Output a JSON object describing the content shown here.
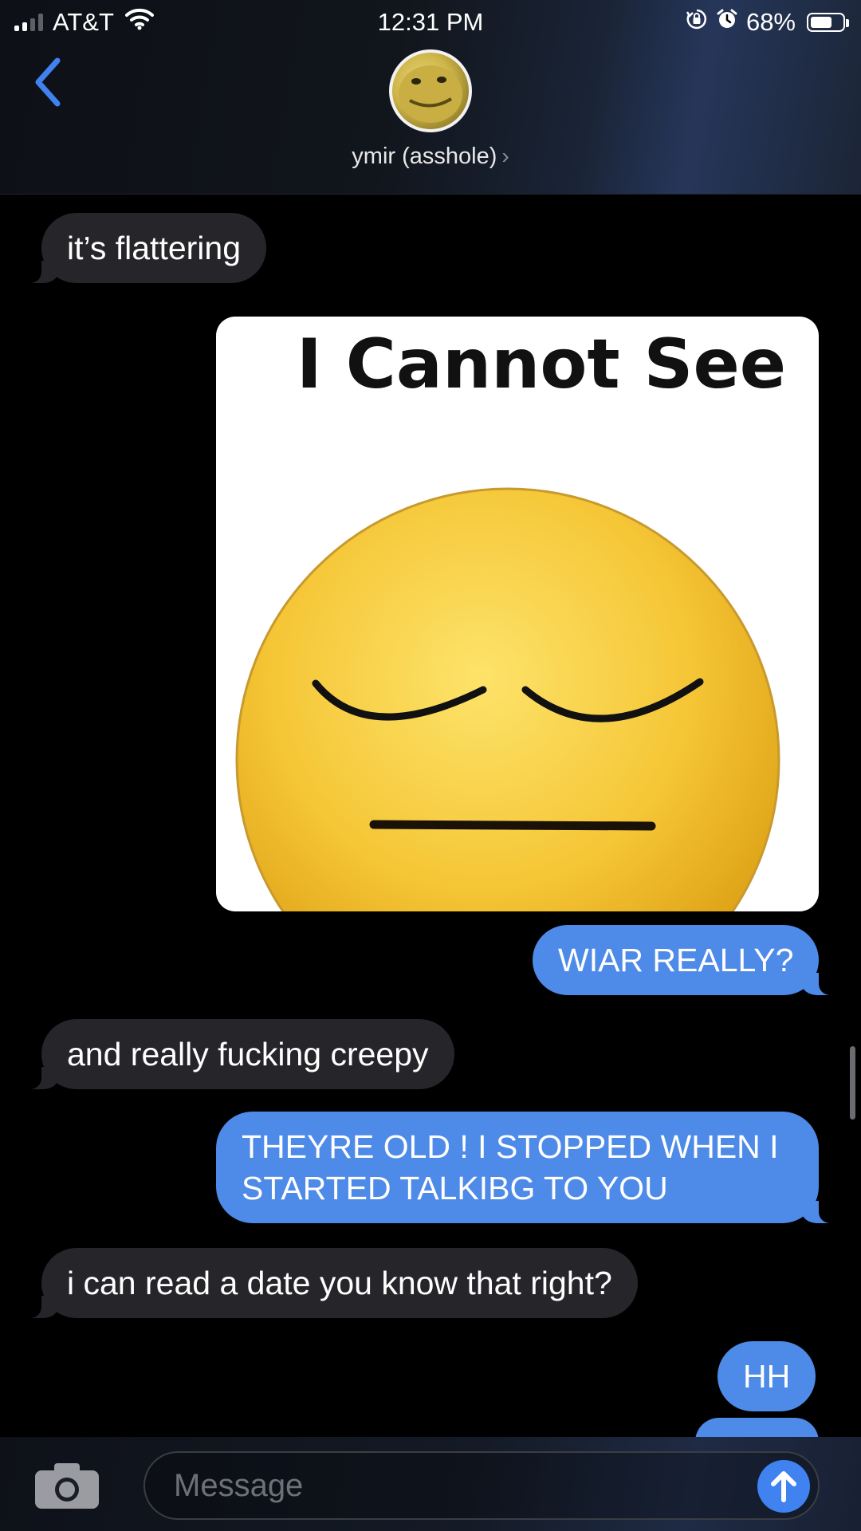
{
  "status_bar": {
    "carrier": "AT&T",
    "time": "12:31 PM",
    "battery_percent": "68%",
    "battery_level": 0.68,
    "icons": [
      "signal-icon",
      "wifi-icon",
      "orientation-lock-icon",
      "alarm-icon",
      "battery-icon"
    ]
  },
  "header": {
    "contact_name": "ymir (asshole)",
    "chevron": "›",
    "icons": [
      "back-chevron-icon",
      "avatar"
    ]
  },
  "messages": [
    {
      "direction": "incoming",
      "text": "it’s flattering"
    },
    {
      "direction": "outgoing",
      "type": "image",
      "caption": "I Cannot See"
    },
    {
      "direction": "outgoing",
      "text": "WIAR REALLY?"
    },
    {
      "direction": "incoming",
      "text": "and really fucking creepy"
    },
    {
      "direction": "outgoing",
      "text": "THEYRE OLD ! I STOPPED WHEN I STARTED TALKIBG TO YOU"
    },
    {
      "direction": "incoming",
      "text": "i can read a date you know that right?"
    },
    {
      "direction": "outgoing",
      "text": "HH"
    }
  ],
  "composer": {
    "placeholder": "Message",
    "icons": [
      "camera-icon",
      "send-arrow-icon"
    ]
  },
  "colors": {
    "incoming_bubble": "#26262a",
    "outgoing_bubble": "#4e8ae8",
    "accent": "#3f82f0",
    "background": "#000000"
  }
}
